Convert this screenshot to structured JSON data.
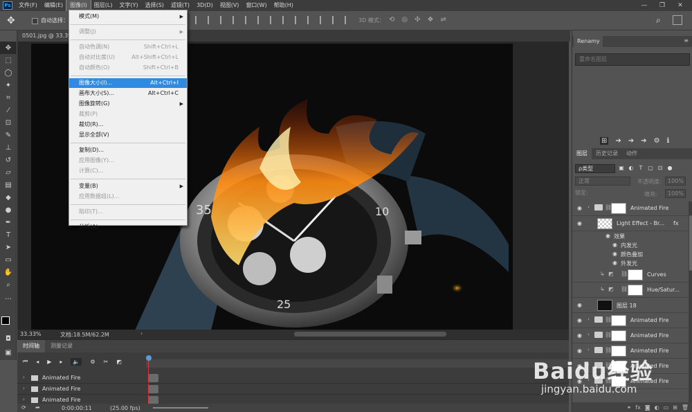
{
  "menubar": {
    "logo": "Ps",
    "items": [
      "文件(F)",
      "编辑(E)",
      "图像(I)",
      "图层(L)",
      "文字(Y)",
      "选择(S)",
      "滤镜(T)",
      "3D(D)",
      "视图(V)",
      "窗口(W)",
      "帮助(H)"
    ],
    "active_index": 2
  },
  "options": {
    "auto_select_label": "自动选择：",
    "mode_3d_label": "3D 模式："
  },
  "document": {
    "tab_title": "0501.jpg @ 33.3%",
    "zoom": "33.33%",
    "doc_size": "文档:18.5M/62.2M"
  },
  "image_menu": [
    {
      "type": "item",
      "label": "模式(M)",
      "submenu": true,
      "disabled": false
    },
    {
      "type": "sep"
    },
    {
      "type": "item",
      "label": "调整(J)",
      "submenu": true,
      "disabled": true
    },
    {
      "type": "sep"
    },
    {
      "type": "item",
      "label": "自动色调(N)",
      "shortcut": "Shift+Ctrl+L",
      "disabled": true
    },
    {
      "type": "item",
      "label": "自动对比度(U)",
      "shortcut": "Alt+Shift+Ctrl+L",
      "disabled": true
    },
    {
      "type": "item",
      "label": "自动颜色(O)",
      "shortcut": "Shift+Ctrl+B",
      "disabled": true
    },
    {
      "type": "sep"
    },
    {
      "type": "item",
      "label": "图像大小(I)...",
      "shortcut": "Alt+Ctrl+I",
      "highlighted": true
    },
    {
      "type": "item",
      "label": "画布大小(S)...",
      "shortcut": "Alt+Ctrl+C"
    },
    {
      "type": "item",
      "label": "图像旋转(G)",
      "submenu": true
    },
    {
      "type": "item",
      "label": "裁剪(P)",
      "disabled": true
    },
    {
      "type": "item",
      "label": "裁切(R)..."
    },
    {
      "type": "item",
      "label": "显示全部(V)"
    },
    {
      "type": "sep"
    },
    {
      "type": "item",
      "label": "复制(D)..."
    },
    {
      "type": "item",
      "label": "应用图像(Y)...",
      "disabled": true
    },
    {
      "type": "item",
      "label": "计算(C)...",
      "disabled": true
    },
    {
      "type": "sep"
    },
    {
      "type": "item",
      "label": "变量(B)",
      "submenu": true
    },
    {
      "type": "item",
      "label": "应用数据组(L)...",
      "disabled": true
    },
    {
      "type": "sep"
    },
    {
      "type": "item",
      "label": "陷印(T)...",
      "disabled": true
    },
    {
      "type": "sep"
    },
    {
      "type": "item",
      "label": "分析(A)",
      "submenu": true
    }
  ],
  "renamy": {
    "title": "Renamy",
    "placeholder": "重命名图层"
  },
  "layers_panel": {
    "tabs": [
      "图层",
      "历史记录",
      "动作"
    ],
    "kind_label": "ρ类型",
    "blend_mode": "正常",
    "opacity_label": "不透明度:",
    "opacity_value": "100%",
    "lock_label": "锁定:",
    "fill_label": "填充:",
    "fill_value": "100%",
    "effects_label": "效果",
    "effects": [
      "内发光",
      "颜色叠加",
      "外发光"
    ],
    "layers": [
      {
        "name": "Animated Fire",
        "kind": "group"
      },
      {
        "name": "Light Effect - Br...",
        "kind": "pattern",
        "fx": "fx"
      },
      {
        "name": "Curves",
        "kind": "adjust"
      },
      {
        "name": "Hue/Satur...",
        "kind": "adjust"
      },
      {
        "name": "图层 18",
        "kind": "layer"
      },
      {
        "name": "Animated Fire",
        "kind": "group"
      },
      {
        "name": "Animated Fire",
        "kind": "group"
      },
      {
        "name": "Animated Fire",
        "kind": "group"
      },
      {
        "name": "Animated Fire",
        "kind": "group"
      },
      {
        "name": "Animated Fire",
        "kind": "group"
      }
    ]
  },
  "timeline": {
    "tabs": [
      "时间轴",
      "测量记录"
    ],
    "tracks": [
      "Animated Fire",
      "Animated Fire",
      "Animated Fire"
    ],
    "time": "0:00:00:11",
    "fps": "(25.00 fps)"
  },
  "watermark": {
    "brand": "Baidu经验",
    "url": "jingyan.baidu.com"
  }
}
